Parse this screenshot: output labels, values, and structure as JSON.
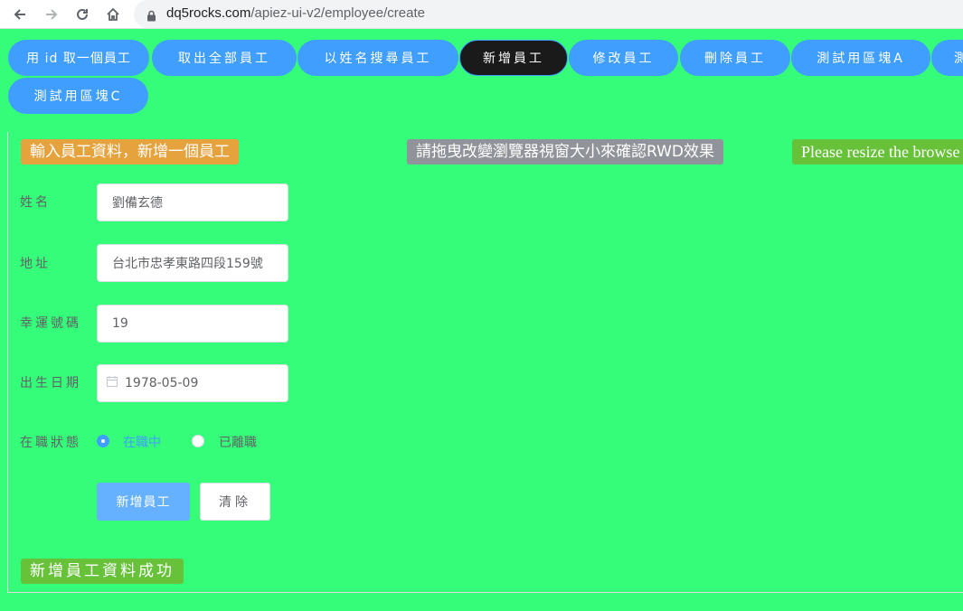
{
  "browser": {
    "url_host": "dq5rocks.com",
    "url_path": "/apiez-ui-v2/employee/create"
  },
  "nav": {
    "items": [
      {
        "label": "用 id 取一個員工",
        "active": false
      },
      {
        "label": "取出全部員工",
        "active": false
      },
      {
        "label": "以姓名搜尋員工",
        "active": false
      },
      {
        "label": "新增員工",
        "active": true
      },
      {
        "label": "修改員工",
        "active": false
      },
      {
        "label": "刪除員工",
        "active": false
      },
      {
        "label": "測試用區塊A",
        "active": false
      },
      {
        "label": "測",
        "active": false
      },
      {
        "label": "測試用區塊C",
        "active": false
      }
    ]
  },
  "header": {
    "form_title": "輸入員工資料，新增一個員工",
    "rwd_hint_zh": "請拖曳改變瀏覽器視窗大小來確認RWD效果",
    "rwd_hint_en": "Please resize the browse"
  },
  "form": {
    "name_label": "姓名",
    "name_value": "劉備玄德",
    "address_label": "地址",
    "address_value": "台北市忠孝東路四段159號",
    "lucky_label": "幸運號碼",
    "lucky_value": "19",
    "birth_label": "出生日期",
    "birth_value": "1978-05-09",
    "status_label": "在職狀態",
    "status_options": [
      {
        "label": "在職中",
        "checked": true
      },
      {
        "label": "已離職",
        "checked": false
      }
    ],
    "submit_label": "新增員工",
    "clear_label": "清除"
  },
  "result": {
    "message": "新增員工資料成功"
  },
  "colors": {
    "page_bg": "#35fc79",
    "primary": "#409eff",
    "warning": "#e6a23c",
    "info": "#909399",
    "success": "#67c23a"
  }
}
